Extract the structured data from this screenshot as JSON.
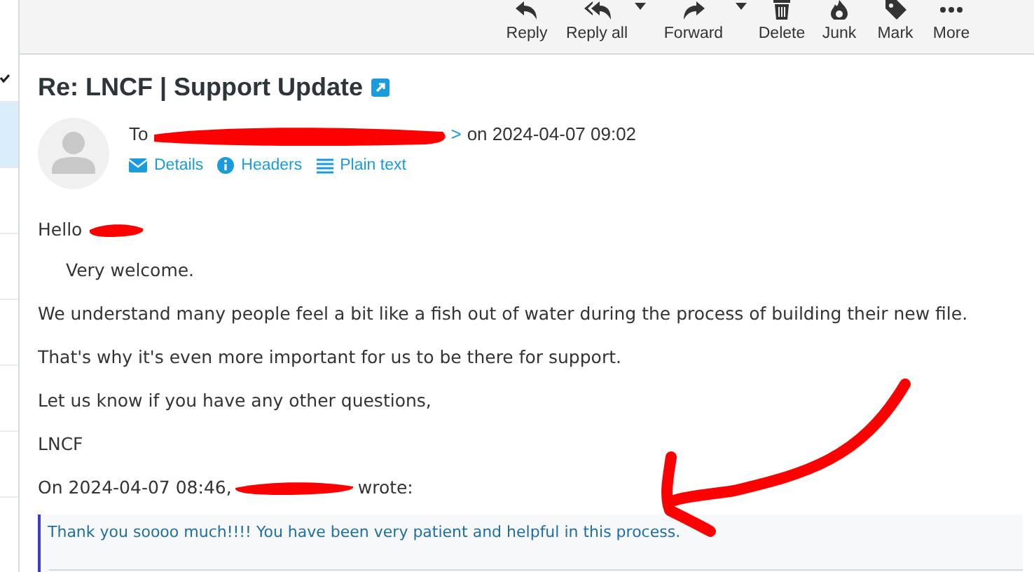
{
  "message_list": {
    "rows": [
      {
        "selected": true
      },
      {
        "selected": false
      },
      {
        "selected": false
      },
      {
        "selected": false
      },
      {
        "selected": false
      },
      {
        "selected": false
      }
    ]
  },
  "toolbar": [
    {
      "kind": "reply",
      "label": "Reply",
      "dropdown": false
    },
    {
      "kind": "reply-all",
      "label": "Reply all",
      "dropdown": true
    },
    {
      "kind": "forward",
      "label": "Forward",
      "dropdown": true
    },
    {
      "kind": "delete",
      "label": "Delete",
      "dropdown": false
    },
    {
      "kind": "junk",
      "label": "Junk",
      "dropdown": false
    },
    {
      "kind": "mark",
      "label": "Mark",
      "dropdown": false
    },
    {
      "kind": "more",
      "label": "More",
      "dropdown": false
    }
  ],
  "message": {
    "subject": "Re: LNCF | Support Update",
    "to_label": "To",
    "to_suffix": ">",
    "date": "on 2024-04-07 09:02",
    "links": [
      {
        "kind": "details",
        "label": "Details"
      },
      {
        "kind": "headers",
        "label": "Headers"
      },
      {
        "kind": "plain",
        "label": "Plain text"
      }
    ],
    "body": [
      {
        "kind": "greeting",
        "text": "Hello"
      },
      {
        "kind": "indented",
        "text": "Very welcome."
      },
      {
        "kind": "paragraph",
        "text": "We understand many people feel a bit like a fish out of water during the process of building their new file."
      },
      {
        "kind": "paragraph",
        "text": "That's why it's even more important for us to be there for support."
      },
      {
        "kind": "paragraph",
        "text": "Let us know if you have any other questions,"
      },
      {
        "kind": "paragraph",
        "text": "LNCF"
      },
      {
        "kind": "attribution",
        "text": "On 2024-04-07 08:46,",
        "after": "wrote:"
      }
    ],
    "quote": "Thank you soooo much!!!! You have been very patient and helpful in this process."
  }
}
